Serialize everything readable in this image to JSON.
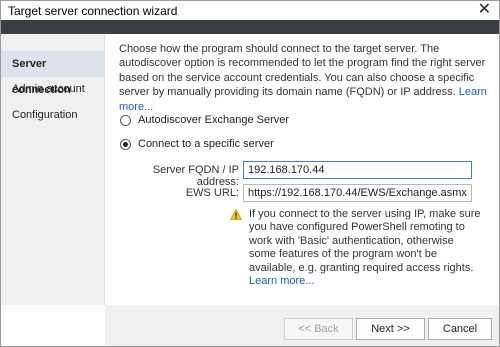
{
  "window": {
    "title": "Target server connection wizard",
    "close_glyph": "✕"
  },
  "sidebar": {
    "items": [
      {
        "label": "Server connection",
        "active": true
      },
      {
        "label": "Admin account",
        "active": false
      },
      {
        "label": "Configuration",
        "active": false
      }
    ]
  },
  "main": {
    "description": "Choose how the program should connect to the target server. The autodiscover option is recommended to let the program find the right server based on the service account credentials. You  can also choose a specific server by manually providing its domain name (FQDN) or IP address.",
    "description_link": "Learn more...",
    "options": [
      {
        "label": "Autodiscover Exchange Server",
        "selected": false
      },
      {
        "label": "Connect to a specific server",
        "selected": true
      }
    ],
    "server_label": "Server FQDN / IP address:",
    "server_value": "192.168.170.44",
    "ews_label": "EWS URL:",
    "ews_value": "https://192.168.170.44/EWS/Exchange.asmx",
    "warning_icon": "warning-triangle-icon",
    "warning_text": "If you connect to the server using IP, make sure you have configured PowerShell remoting to work with 'Basic' authentication, otherwise some features of the program won't be available, e.g. granting required access rights.",
    "warning_link": "Learn more..."
  },
  "footer": {
    "back_label": "<< Back",
    "next_label": "Next >>",
    "cancel_label": "Cancel"
  },
  "colors": {
    "accent": "#3c7fd6",
    "link": "#1a5fb4",
    "dark_bar": "#3b3f45",
    "warning": "#f0c419"
  }
}
